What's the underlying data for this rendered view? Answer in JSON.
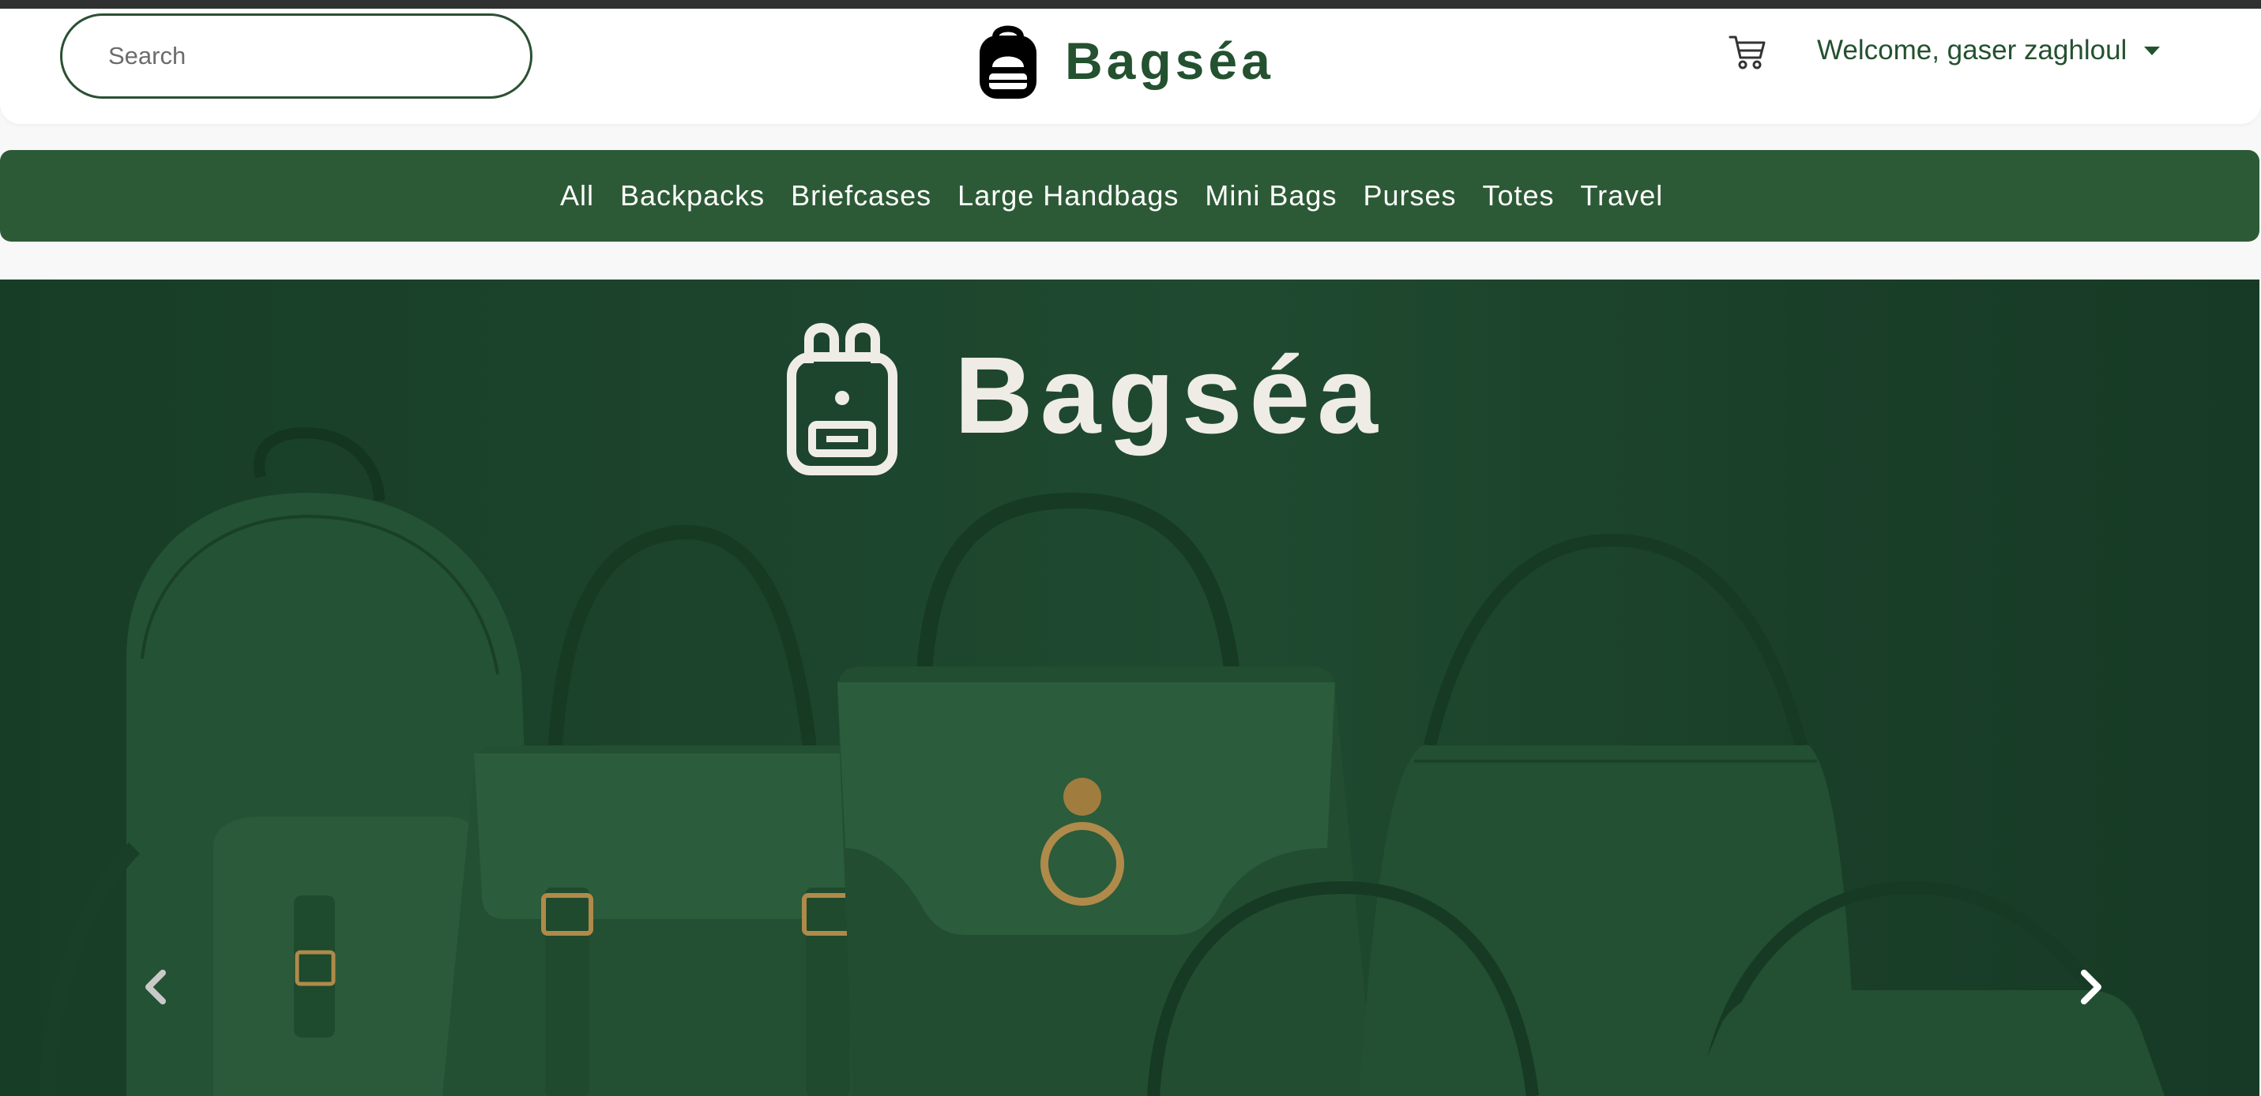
{
  "search": {
    "placeholder": "Search"
  },
  "brand": {
    "name": "Bagséa",
    "logo_icon": "backpack-icon"
  },
  "header": {
    "cart_icon": "cart-icon",
    "welcome_text": "Welcome, gaser zaghloul"
  },
  "categories": [
    "All",
    "Backpacks",
    "Briefcases",
    "Large Handbags",
    "Mini Bags",
    "Purses",
    "Totes",
    "Travel"
  ],
  "hero": {
    "brand_name": "Bagséa",
    "prev_icon": "chevron-left-icon",
    "next_icon": "chevron-right-icon"
  },
  "colors": {
    "brand_green": "#24512f",
    "nav_green": "#2d5a36",
    "hero_green": "#1c432c",
    "top_bar": "#2f3130"
  }
}
